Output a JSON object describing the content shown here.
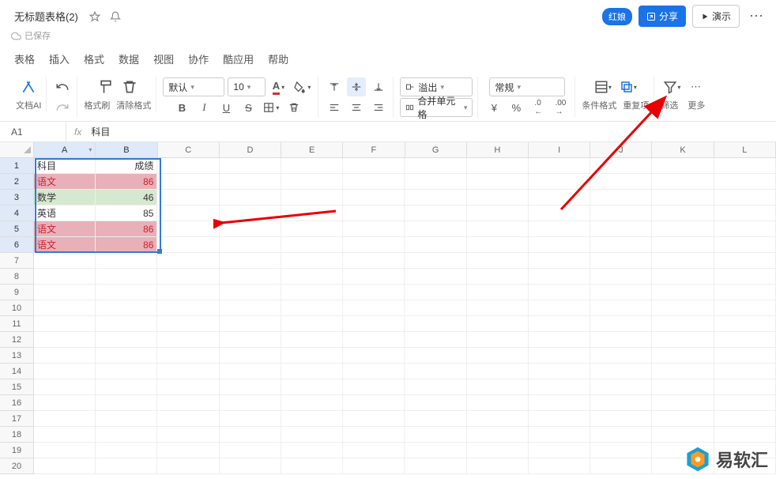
{
  "titlebar": {
    "doc_title": "无标题表格(2)",
    "saved_label": "已保存",
    "badge": "红娘",
    "share": "分享",
    "present": "演示"
  },
  "menubar": [
    "表格",
    "插入",
    "格式",
    "数据",
    "视图",
    "协作",
    "酷应用",
    "帮助"
  ],
  "toolbar": {
    "ai": "文档AI",
    "format_painter": "格式刷",
    "clear_format": "清除格式",
    "font_name": "默认",
    "font_size": "10",
    "overflow": "溢出",
    "merge": "合并单元格",
    "number_format": "常规",
    "rmb": "¥",
    "percent": "%",
    "dec0": ".0",
    "dec00": ".00",
    "cond_fmt": "条件格式",
    "dup_items": "重复项",
    "filter": "筛选",
    "more": "更多"
  },
  "cellref": {
    "ref": "A1",
    "fx": "fx",
    "formula": "科目"
  },
  "columns": [
    "A",
    "B",
    "C",
    "D",
    "E",
    "F",
    "G",
    "H",
    "I",
    "J",
    "K",
    "L"
  ],
  "rows": [
    "1",
    "2",
    "3",
    "4",
    "5",
    "6",
    "7",
    "8",
    "9",
    "10",
    "11",
    "12",
    "13",
    "14",
    "15",
    "16",
    "17",
    "18",
    "19",
    "20"
  ],
  "cells": {
    "A1": "科目",
    "B1": "成绩",
    "A2": "语文",
    "B2": "86",
    "A3": "数学",
    "B3": "46",
    "A4": "英语",
    "B4": "85",
    "A5": "语文",
    "B5": "86",
    "A6": "语文",
    "B6": "86"
  },
  "watermark": "易软汇"
}
